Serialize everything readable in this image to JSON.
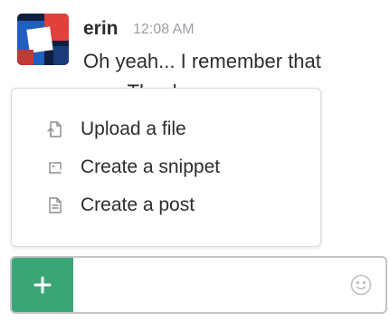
{
  "message": {
    "username": "erin",
    "timestamp": "12:08 AM",
    "text": "Oh yeah... I remember that one. Thanks"
  },
  "menu": {
    "items": [
      {
        "label": "Upload a file",
        "icon": "upload-file-icon"
      },
      {
        "label": "Create a snippet",
        "icon": "snippet-icon"
      },
      {
        "label": "Create a post",
        "icon": "post-icon"
      }
    ]
  },
  "composer": {
    "plus_icon": "plus-icon",
    "input_value": "",
    "emoji_icon": "smiley-icon"
  },
  "colors": {
    "accent_green": "#3aa676",
    "avatar_blue": "#1f5fbf",
    "avatar_red": "#e0413a",
    "avatar_navy": "#0e1f40"
  }
}
